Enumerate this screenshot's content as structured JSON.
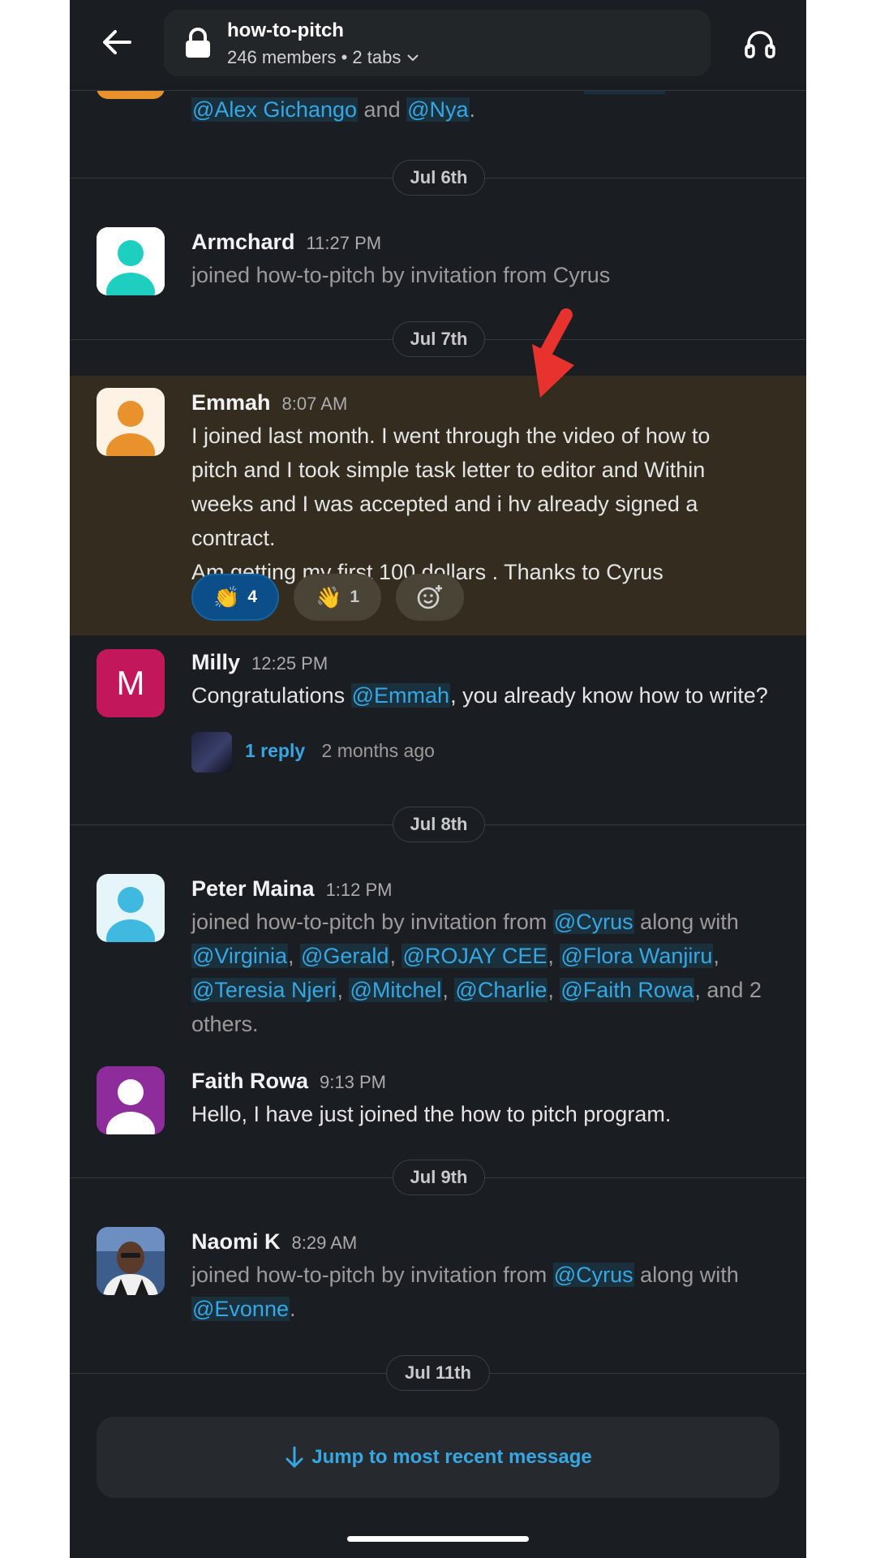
{
  "header": {
    "channel_name": "how-to-pitch",
    "channel_meta": "246 members • 2 tabs"
  },
  "partial_message": {
    "mention_1": "@Alex Gichango",
    "and_text": "and",
    "mention_2": "@Nya",
    "end": "."
  },
  "date_dividers": [
    "Jul 6th",
    "Jul 7th",
    "Jul 8th",
    "Jul 9th",
    "Jul 11th"
  ],
  "messages": {
    "armchard": {
      "name": "Armchard",
      "time": "11:27 PM",
      "text": "joined how-to-pitch by invitation from Cyrus",
      "avatar_color": "#1ecfc0"
    },
    "emmah": {
      "name": "Emmah",
      "time": "8:07 AM",
      "lines": [
        "I joined last month.  I went through the video of how to",
        "pitch and I took simple task letter to editor and Within",
        "weeks and I was accepted and i hv already signed a contract.",
        "Am getting my first  100 dollars .  Thanks to Cyrus"
      ],
      "avatar_color": "#e8912d",
      "reactions": [
        {
          "emoji": "👏",
          "count": "4",
          "selected": true
        },
        {
          "emoji": "👋",
          "count": "1",
          "selected": false
        }
      ]
    },
    "milly": {
      "name": "Milly",
      "time": "12:25 PM",
      "avatar_letter": "M",
      "avatar_color": "#c2185b",
      "text_before": "Congratulations ",
      "mention": "@Emmah",
      "text_after": ", you already know how to write?",
      "reply_count": "1 reply",
      "reply_time": "2 months ago"
    },
    "peter": {
      "name": "Peter Maina",
      "time": "1:12 PM",
      "avatar_color": "#3fb9e0",
      "text_intro": "joined how-to-pitch by invitation from",
      "mention_cyrus": "@Cyrus",
      "along_with": "along with",
      "mentions": [
        "@Virginia",
        "@Gerald",
        "@ROJAY CEE",
        "@Flora Wanjiru",
        "@Teresia Njeri",
        "@Mitchel",
        "@Charlie",
        "@Faith Rowa"
      ],
      "and_more": ", and 2",
      "others": "others."
    },
    "faith": {
      "name": "Faith Rowa",
      "time": "9:13 PM",
      "avatar_color": "#8e2c9b",
      "text": "Hello, I have just joined the how to pitch program."
    },
    "naomi": {
      "name": "Naomi K",
      "time": "8:29 AM",
      "text_intro": "joined how-to-pitch by invitation from",
      "mention_cyrus": "@Cyrus",
      "along_with": "along with",
      "mention_evonne": "@Evonne",
      "end": "."
    }
  },
  "jump_button": {
    "label": "Jump to most recent message"
  },
  "colors": {
    "background": "#1a1d21",
    "highlight": "#342c1e",
    "mention": "#36a7e2",
    "arrow": "#e8322e"
  }
}
